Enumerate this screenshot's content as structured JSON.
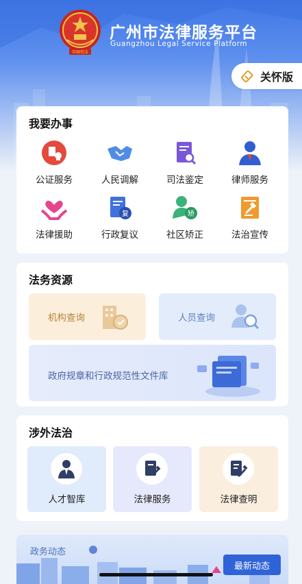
{
  "header": {
    "emblem_text": "中国司法",
    "title": "广州市法律服务平台",
    "subtitle": "Guangzhou Legal Service Platform",
    "care_mode_label": "关怀版"
  },
  "services": {
    "title": "我要办事",
    "items": [
      {
        "label": "公证服务",
        "icon": "notary-icon"
      },
      {
        "label": "人民调解",
        "icon": "handshake-icon"
      },
      {
        "label": "司法鉴定",
        "icon": "appraisal-icon"
      },
      {
        "label": "律师服务",
        "icon": "lawyer-icon"
      },
      {
        "label": "法律援助",
        "icon": "legal-aid-icon"
      },
      {
        "label": "行政复议",
        "icon": "review-icon",
        "badge": "复"
      },
      {
        "label": "社区矫正",
        "icon": "correction-icon",
        "badge": "矫"
      },
      {
        "label": "法治宣传",
        "icon": "publicity-icon"
      }
    ]
  },
  "resources": {
    "title": "法务资源",
    "org_query": "机构查询",
    "person_query": "人员查询",
    "regulations": "政府规章和行政规范性文件库"
  },
  "foreign": {
    "title": "涉外法治",
    "items": [
      {
        "label": "人才智库"
      },
      {
        "label": "法律服务"
      },
      {
        "label": "法律查明"
      }
    ]
  },
  "news": {
    "label": "政务动态",
    "latest_button": "最新动态"
  },
  "colors": {
    "header_blue": "#3f77e6",
    "button_blue": "#2f63d8",
    "org_box": "#fbefdc",
    "person_box": "#e3ecfb"
  }
}
